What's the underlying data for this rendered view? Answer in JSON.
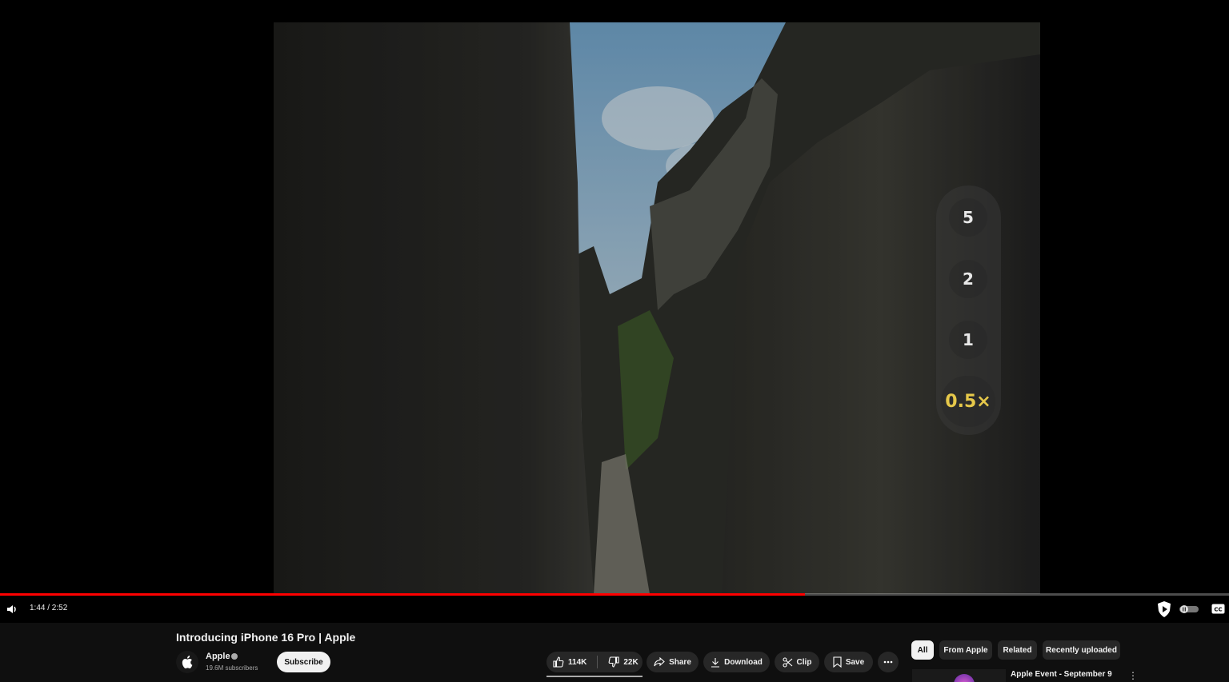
{
  "player": {
    "zoom_levels": [
      "5",
      "2",
      "1",
      "0.5×"
    ],
    "active_zoom": "0.5×",
    "time_display": "1:44 / 2:52",
    "progress_fraction": 0.655,
    "icons": [
      "volume-icon",
      "autoplay-toggle-icon",
      "captions-icon",
      "adblock-shield-icon"
    ]
  },
  "video": {
    "title": "Introducing iPhone 16 Pro | Apple"
  },
  "channel": {
    "name": "Apple",
    "subscribers": "19.6M subscribers",
    "subscribe_label": "Subscribe"
  },
  "actions": {
    "likes": "114K",
    "dislikes": "22K",
    "share": "Share",
    "download": "Download",
    "clip": "Clip",
    "save": "Save"
  },
  "chips": [
    "All",
    "From Apple",
    "Related",
    "Recently uploaded"
  ],
  "recommendation": {
    "title": "Apple Event - September 9"
  },
  "colors": {
    "progress": "#ff0000",
    "active_zoom": "#e6c84a",
    "background": "#0f0f0f"
  }
}
